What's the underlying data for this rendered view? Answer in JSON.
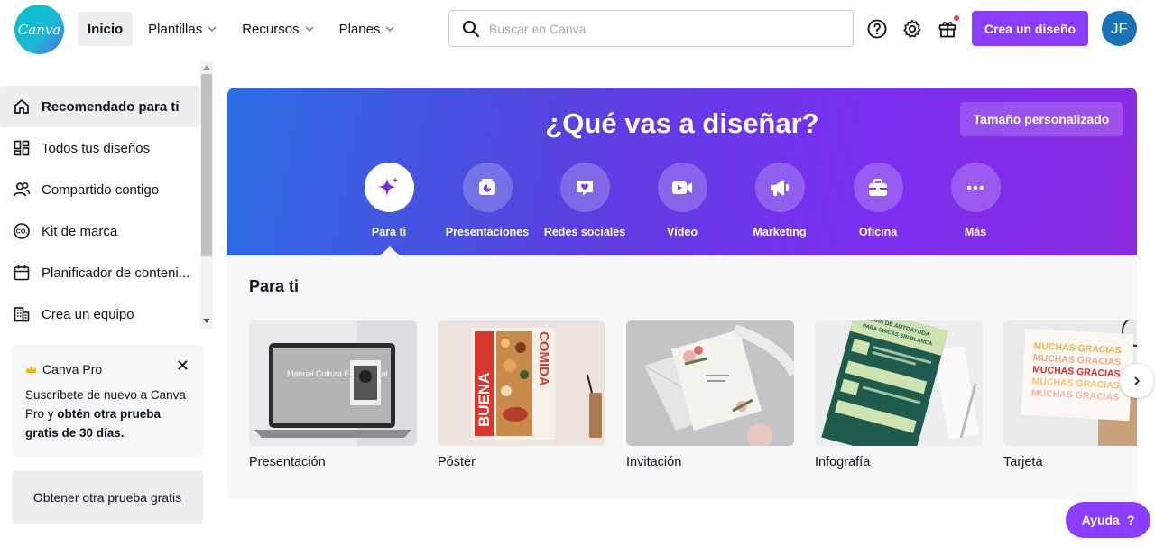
{
  "brand": {
    "logo_text": "Canva",
    "accent": "#8b3dff",
    "teal": "#00c4cc"
  },
  "nav": {
    "items": [
      {
        "label": "Inicio",
        "active": true
      },
      {
        "label": "Plantillas",
        "dropdown": true
      },
      {
        "label": "Recursos",
        "dropdown": true
      },
      {
        "label": "Planes",
        "dropdown": true
      }
    ]
  },
  "search": {
    "placeholder": "Buscar en Canva",
    "value": ""
  },
  "header": {
    "icons": [
      "help-icon",
      "gear-icon",
      "gift-icon"
    ],
    "create_label": "Crea un diseño",
    "avatar_initials": "JF"
  },
  "sidebar": {
    "items": [
      {
        "label": "Recomendado para ti",
        "icon": "home-icon",
        "active": true
      },
      {
        "label": "Todos tus diseños",
        "icon": "grid-icon"
      },
      {
        "label": "Compartido contigo",
        "icon": "people-icon"
      },
      {
        "label": "Kit de marca",
        "icon": "brand-kit-icon"
      },
      {
        "label": "Planificador de conteni...",
        "icon": "calendar-icon"
      },
      {
        "label": "Crea un equipo",
        "icon": "building-icon"
      }
    ],
    "pro": {
      "title": "Canva Pro",
      "text_pre": "Suscríbete de nuevo a Canva Pro y ",
      "text_bold": "obtén otra prueba gratis de 30 días.",
      "button": "Obtener otra prueba gratis"
    }
  },
  "banner": {
    "title": "¿Qué vas a diseñar?",
    "custom_size": "Tamaño personalizado",
    "categories": [
      {
        "label": "Para ti",
        "icon": "sparkle-icon",
        "active": true
      },
      {
        "label": "Presentaciones",
        "icon": "presentation-icon"
      },
      {
        "label": "Redes sociales",
        "icon": "heart-chat-icon"
      },
      {
        "label": "Vídeo",
        "icon": "video-icon"
      },
      {
        "label": "Marketing",
        "icon": "megaphone-icon"
      },
      {
        "label": "Oficina",
        "icon": "briefcase-icon"
      },
      {
        "label": "Más",
        "icon": "more-icon"
      }
    ]
  },
  "section": {
    "title": "Para ti",
    "cards": [
      {
        "label": "Presentación",
        "thumb_text": "Manual Cultura Empresarial"
      },
      {
        "label": "Póster",
        "thumb_text": "BUENA COMIDA"
      },
      {
        "label": "Invitación"
      },
      {
        "label": "Infografía",
        "thumb_text": "GUÍA DE AUTOAYUDA PARA CHICAS SIN BLANCA"
      },
      {
        "label": "Tarjeta",
        "thumb_text": "MUCHAS GRACIAS"
      }
    ]
  },
  "help": {
    "label": "Ayuda",
    "icon": "?"
  }
}
